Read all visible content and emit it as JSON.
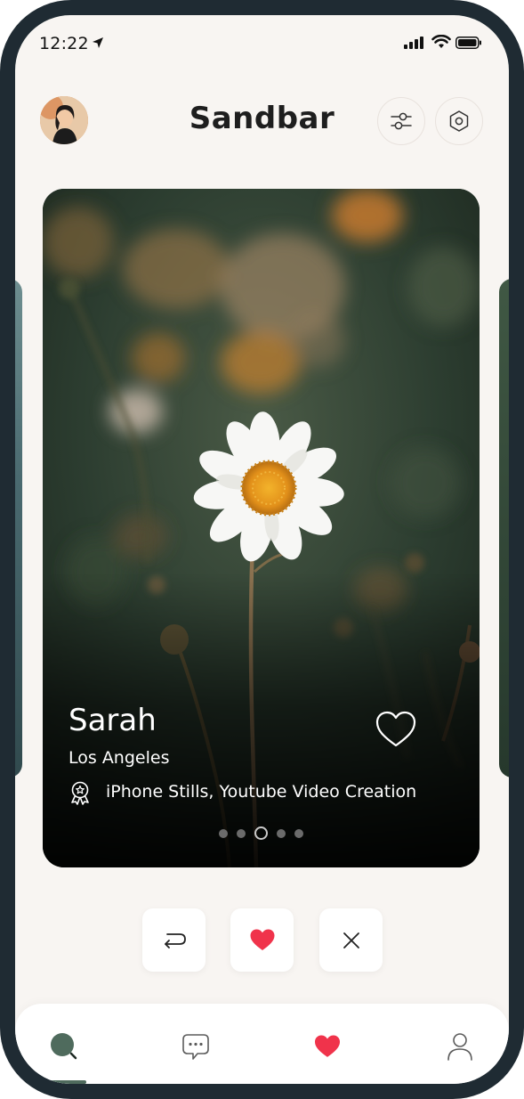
{
  "status_bar": {
    "time": "12:22"
  },
  "header": {
    "app_title": "Sandbar"
  },
  "profile_card": {
    "name": "Sarah",
    "location": "Los Angeles",
    "interests": "iPhone Stills, Youtube Video Creation",
    "photo_count": 5,
    "active_photo_index": 2
  },
  "actions": {
    "rewind_icon": "rewind-arrow-icon",
    "like_icon": "heart-icon",
    "pass_icon": "close-icon"
  },
  "tabbar": {
    "items": [
      "discover",
      "messages",
      "likes",
      "profile"
    ],
    "active": "discover"
  },
  "colors": {
    "background": "#f8f5f2",
    "accent_green": "#4f6b5d",
    "heart_red": "#f0334b",
    "title": "#1e1e1e",
    "frame": "#1f2b33"
  }
}
